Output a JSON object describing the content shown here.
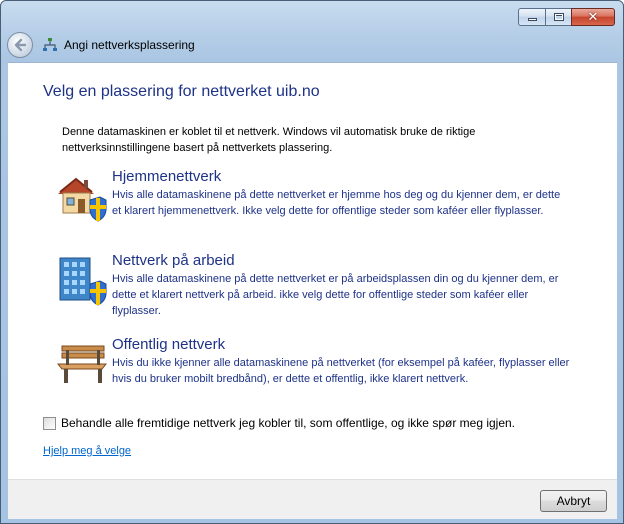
{
  "window": {
    "title": "Angi nettverksplassering",
    "caption_buttons": [
      "minimize",
      "maximize",
      "close"
    ]
  },
  "navbar": {
    "back_icon": "back-arrow-icon",
    "network_icon": "network-icon"
  },
  "main": {
    "heading": "Velg en plassering for nettverket uib.no",
    "description": "Denne datamaskinen er koblet til et nettverk. Windows vil automatisk bruke de riktige nettverksinnstillingene basert på nettverkets plassering.",
    "options": [
      {
        "title": "Hjemmenettverk",
        "text": "Hvis alle datamaskinene på dette nettverket er hjemme hos deg og du kjenner dem, er dette et klarert hjemmenettverk. Ikke velg dette for offentlige steder som kaféer eller flyplasser.",
        "icon": "home-network-icon"
      },
      {
        "title": "Nettverk på arbeid",
        "text": "Hvis alle datamaskinene på dette nettverket er på arbeidsplassen din og du kjenner dem, er dette et klarert nettverk på arbeid. ikke velg dette for offentlige steder som kaféer eller flyplasser.",
        "icon": "work-network-icon"
      },
      {
        "title": "Offentlig nettverk",
        "text": "Hvis du ikke kjenner alle datamaskinene på nettverket (for eksempel på kaféer, flyplasser eller hvis du bruker mobilt bredbånd), er dette et offentlig, ikke klarert nettverk.",
        "icon": "public-network-bench-icon"
      }
    ],
    "checkbox": {
      "label": "Behandle alle fremtidige nettverk jeg kobler til, som offentlige, og ikke spør meg igjen.",
      "checked": false
    },
    "help_link": "Hjelp meg å velge"
  },
  "footer": {
    "cancel_label": "Avbryt"
  },
  "colors": {
    "heading": "#1e3287",
    "link": "#0066cc",
    "frame": "#aac6e3"
  }
}
